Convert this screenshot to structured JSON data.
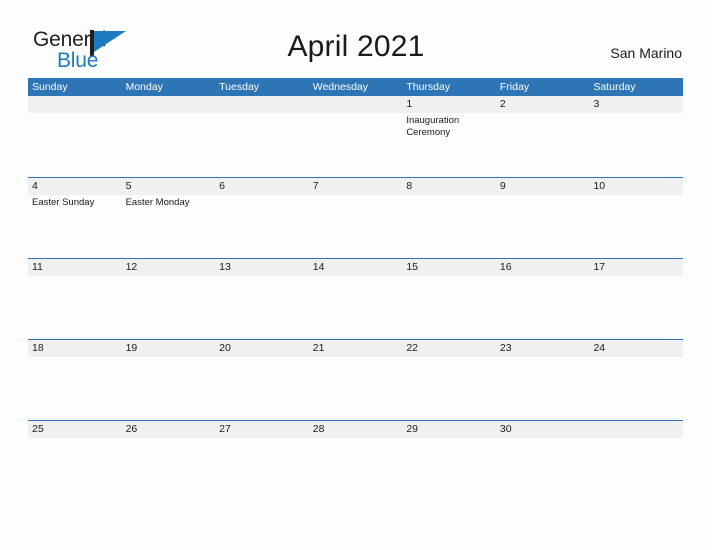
{
  "brand": {
    "name_part1": "General",
    "name_part2": "Blue",
    "flag_icon": "flag-icon",
    "accent_color": "#1f7bc1"
  },
  "header": {
    "title": "April 2021",
    "location": "San Marino"
  },
  "colors": {
    "header_blue": "#2e75b6",
    "row_band_gray": "#f0f0f0",
    "page_background": "#fdfdfd",
    "text": "#1a1a1a"
  },
  "calendar": {
    "month": "April",
    "year": "2021",
    "weekday_headers": [
      "Sunday",
      "Monday",
      "Tuesday",
      "Wednesday",
      "Thursday",
      "Friday",
      "Saturday"
    ],
    "weeks": [
      {
        "days": [
          {
            "number": "",
            "event": ""
          },
          {
            "number": "",
            "event": ""
          },
          {
            "number": "",
            "event": ""
          },
          {
            "number": "",
            "event": ""
          },
          {
            "number": "1",
            "event": "Inauguration Ceremony"
          },
          {
            "number": "2",
            "event": ""
          },
          {
            "number": "3",
            "event": ""
          }
        ]
      },
      {
        "days": [
          {
            "number": "4",
            "event": "Easter Sunday"
          },
          {
            "number": "5",
            "event": "Easter Monday"
          },
          {
            "number": "6",
            "event": ""
          },
          {
            "number": "7",
            "event": ""
          },
          {
            "number": "8",
            "event": ""
          },
          {
            "number": "9",
            "event": ""
          },
          {
            "number": "10",
            "event": ""
          }
        ]
      },
      {
        "days": [
          {
            "number": "11",
            "event": ""
          },
          {
            "number": "12",
            "event": ""
          },
          {
            "number": "13",
            "event": ""
          },
          {
            "number": "14",
            "event": ""
          },
          {
            "number": "15",
            "event": ""
          },
          {
            "number": "16",
            "event": ""
          },
          {
            "number": "17",
            "event": ""
          }
        ]
      },
      {
        "days": [
          {
            "number": "18",
            "event": ""
          },
          {
            "number": "19",
            "event": ""
          },
          {
            "number": "20",
            "event": ""
          },
          {
            "number": "21",
            "event": ""
          },
          {
            "number": "22",
            "event": ""
          },
          {
            "number": "23",
            "event": ""
          },
          {
            "number": "24",
            "event": ""
          }
        ]
      },
      {
        "days": [
          {
            "number": "25",
            "event": ""
          },
          {
            "number": "26",
            "event": ""
          },
          {
            "number": "27",
            "event": ""
          },
          {
            "number": "28",
            "event": ""
          },
          {
            "number": "29",
            "event": ""
          },
          {
            "number": "30",
            "event": ""
          },
          {
            "number": "",
            "event": ""
          }
        ]
      }
    ]
  }
}
